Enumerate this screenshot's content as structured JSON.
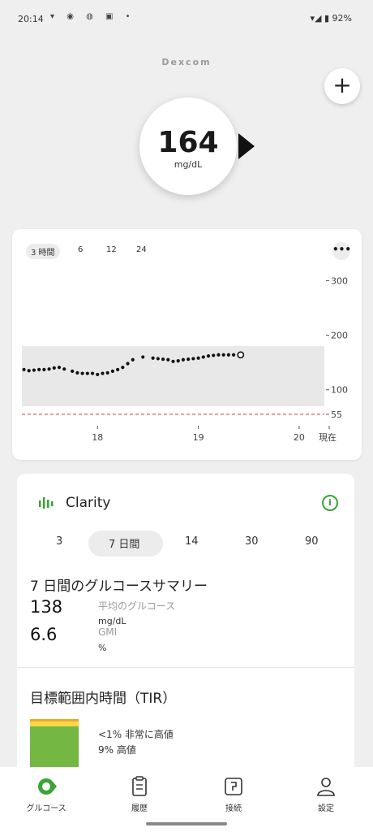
{
  "status_bar": {
    "time": "20:14",
    "icons_left": "▾ ◉ ◍ ▣ •",
    "battery": "92%"
  },
  "brand": "Dexcom",
  "glucose": {
    "value": "164",
    "unit": "mg/dL"
  },
  "chart": {
    "range_tabs": [
      "3 時間",
      "6",
      "12",
      "24"
    ],
    "active_range": "3 時間"
  },
  "chart_data": {
    "type": "scatter",
    "title": "",
    "xlabel": "",
    "ylabel": "",
    "x_ticks": [
      "18",
      "19",
      "20",
      "現在"
    ],
    "y_ticks": [
      "300",
      "200",
      "100",
      "55"
    ],
    "ylim": [
      40,
      320
    ],
    "target_range": [
      70,
      180
    ],
    "urgent_low_line": 55,
    "x_range_hours": [
      17.25,
      20.25
    ],
    "series": [
      {
        "x": [
          17.27,
          17.32,
          17.37,
          17.42,
          17.47,
          17.52,
          17.57,
          17.62,
          17.67,
          17.75,
          17.8,
          17.85,
          17.9,
          17.95,
          18.0,
          18.05,
          18.1,
          18.15,
          18.2,
          18.25,
          18.3,
          18.35,
          18.45,
          18.55,
          18.6,
          18.65,
          18.7,
          18.75,
          18.8,
          18.85,
          18.9,
          18.95,
          19.0,
          19.05,
          19.1,
          19.15,
          19.2,
          19.25,
          19.3,
          19.35,
          19.42
        ],
        "y": [
          137,
          135,
          136,
          137,
          137,
          138,
          140,
          141,
          138,
          134,
          131,
          130,
          130,
          130,
          128,
          130,
          131,
          134,
          137,
          141,
          148,
          155,
          160,
          158,
          157,
          156,
          155,
          152,
          153,
          155,
          156,
          157,
          158,
          160,
          162,
          163,
          164,
          164,
          164,
          164,
          164
        ]
      }
    ],
    "current_point": 164
  },
  "clarity": {
    "title": "Clarity",
    "periods": [
      "3",
      "7 日間",
      "14",
      "30",
      "90"
    ],
    "active_period": "7 日間",
    "summary_title": "7 日間のグルコースサマリー",
    "avg_glucose_value": "138",
    "avg_glucose_label": "平均のグルコース",
    "avg_glucose_unit": "mg/dL",
    "gmi_value": "6.6",
    "gmi_label": "GMI",
    "gmi_unit": "%",
    "tir_title": "目標範囲内時間（TIR）",
    "tir_very_high": "<1% 非常に高値",
    "tir_high": "9% 高値",
    "tir_very_high_pct": 1,
    "tir_high_pct": 9,
    "tir_in_range_pct": 90,
    "colors": {
      "very_high": "#f5a623",
      "high": "#f7d84a",
      "in_range": "#74b843"
    }
  },
  "bottom_nav": {
    "items": [
      {
        "label": "グルコース"
      },
      {
        "label": "履歴"
      },
      {
        "label": "接続"
      },
      {
        "label": "設定"
      }
    ]
  }
}
